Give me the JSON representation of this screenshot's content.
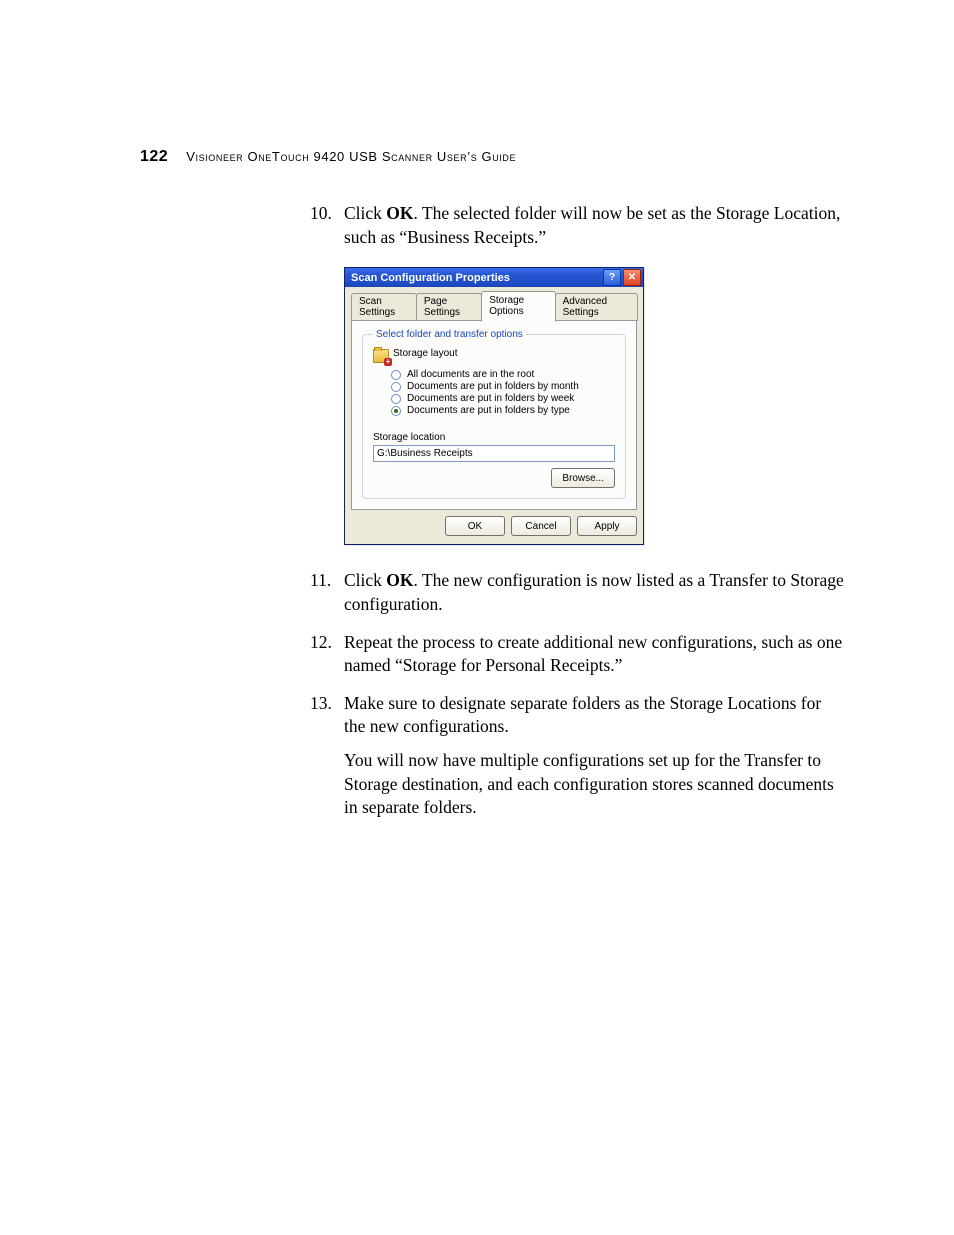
{
  "page": {
    "number": "122",
    "header_caps": "V",
    "header_rest": "ISIONEER",
    "header_mid_cap": "O",
    "header_mid_rest": "NE",
    "header_mid2_cap": "T",
    "header_mid2_rest": "OUCH",
    "header_num": "9420 USB S",
    "header_tail1": "CANNER",
    "header_user_cap": "U",
    "header_user_rest": "SER",
    "header_apos": "’",
    "header_s": "S",
    "header_guide_cap": "G",
    "header_guide_rest": "UIDE",
    "header_full": "Visioneer OneTouch 9420 USB Scanner User’s Guide"
  },
  "steps": {
    "s10_num": "10.",
    "s10_pre": "Click ",
    "s10_bold": "OK",
    "s10_post": ". The selected folder will now be set as the Storage Location, such as “Business Receipts.”",
    "s11_num": "11.",
    "s11_pre": "Click ",
    "s11_bold": "OK",
    "s11_post": ". The new configuration is now listed as a Transfer to Storage configuration.",
    "s12_num": "12.",
    "s12_text": "Repeat the process to create additional new configurations, such as one named “Storage for Personal Receipts.”",
    "s13_num": "13.",
    "s13_text": "Make sure to designate separate folders as the Storage Locations for the new configurations.",
    "s13_para": "You will now have multiple configurations set up for the Transfer to Storage destination, and each configuration stores scanned documents in separate folders."
  },
  "dialog": {
    "title": "Scan Configuration Properties",
    "tabs": [
      "Scan Settings",
      "Page Settings",
      "Storage Options",
      "Advanced Settings"
    ],
    "group_legend": "Select folder and transfer options",
    "layout_label": "Storage layout",
    "radios": [
      "All documents are in the root",
      "Documents are put in folders by month",
      "Documents are put in folders by week",
      "Documents are put in folders by type"
    ],
    "selected_radio": 3,
    "location_label": "Storage location",
    "path_value": "G:\\Business Receipts",
    "browse": "Browse...",
    "ok": "OK",
    "cancel": "Cancel",
    "apply": "Apply",
    "help_glyph": "?",
    "close_glyph": "✕"
  }
}
